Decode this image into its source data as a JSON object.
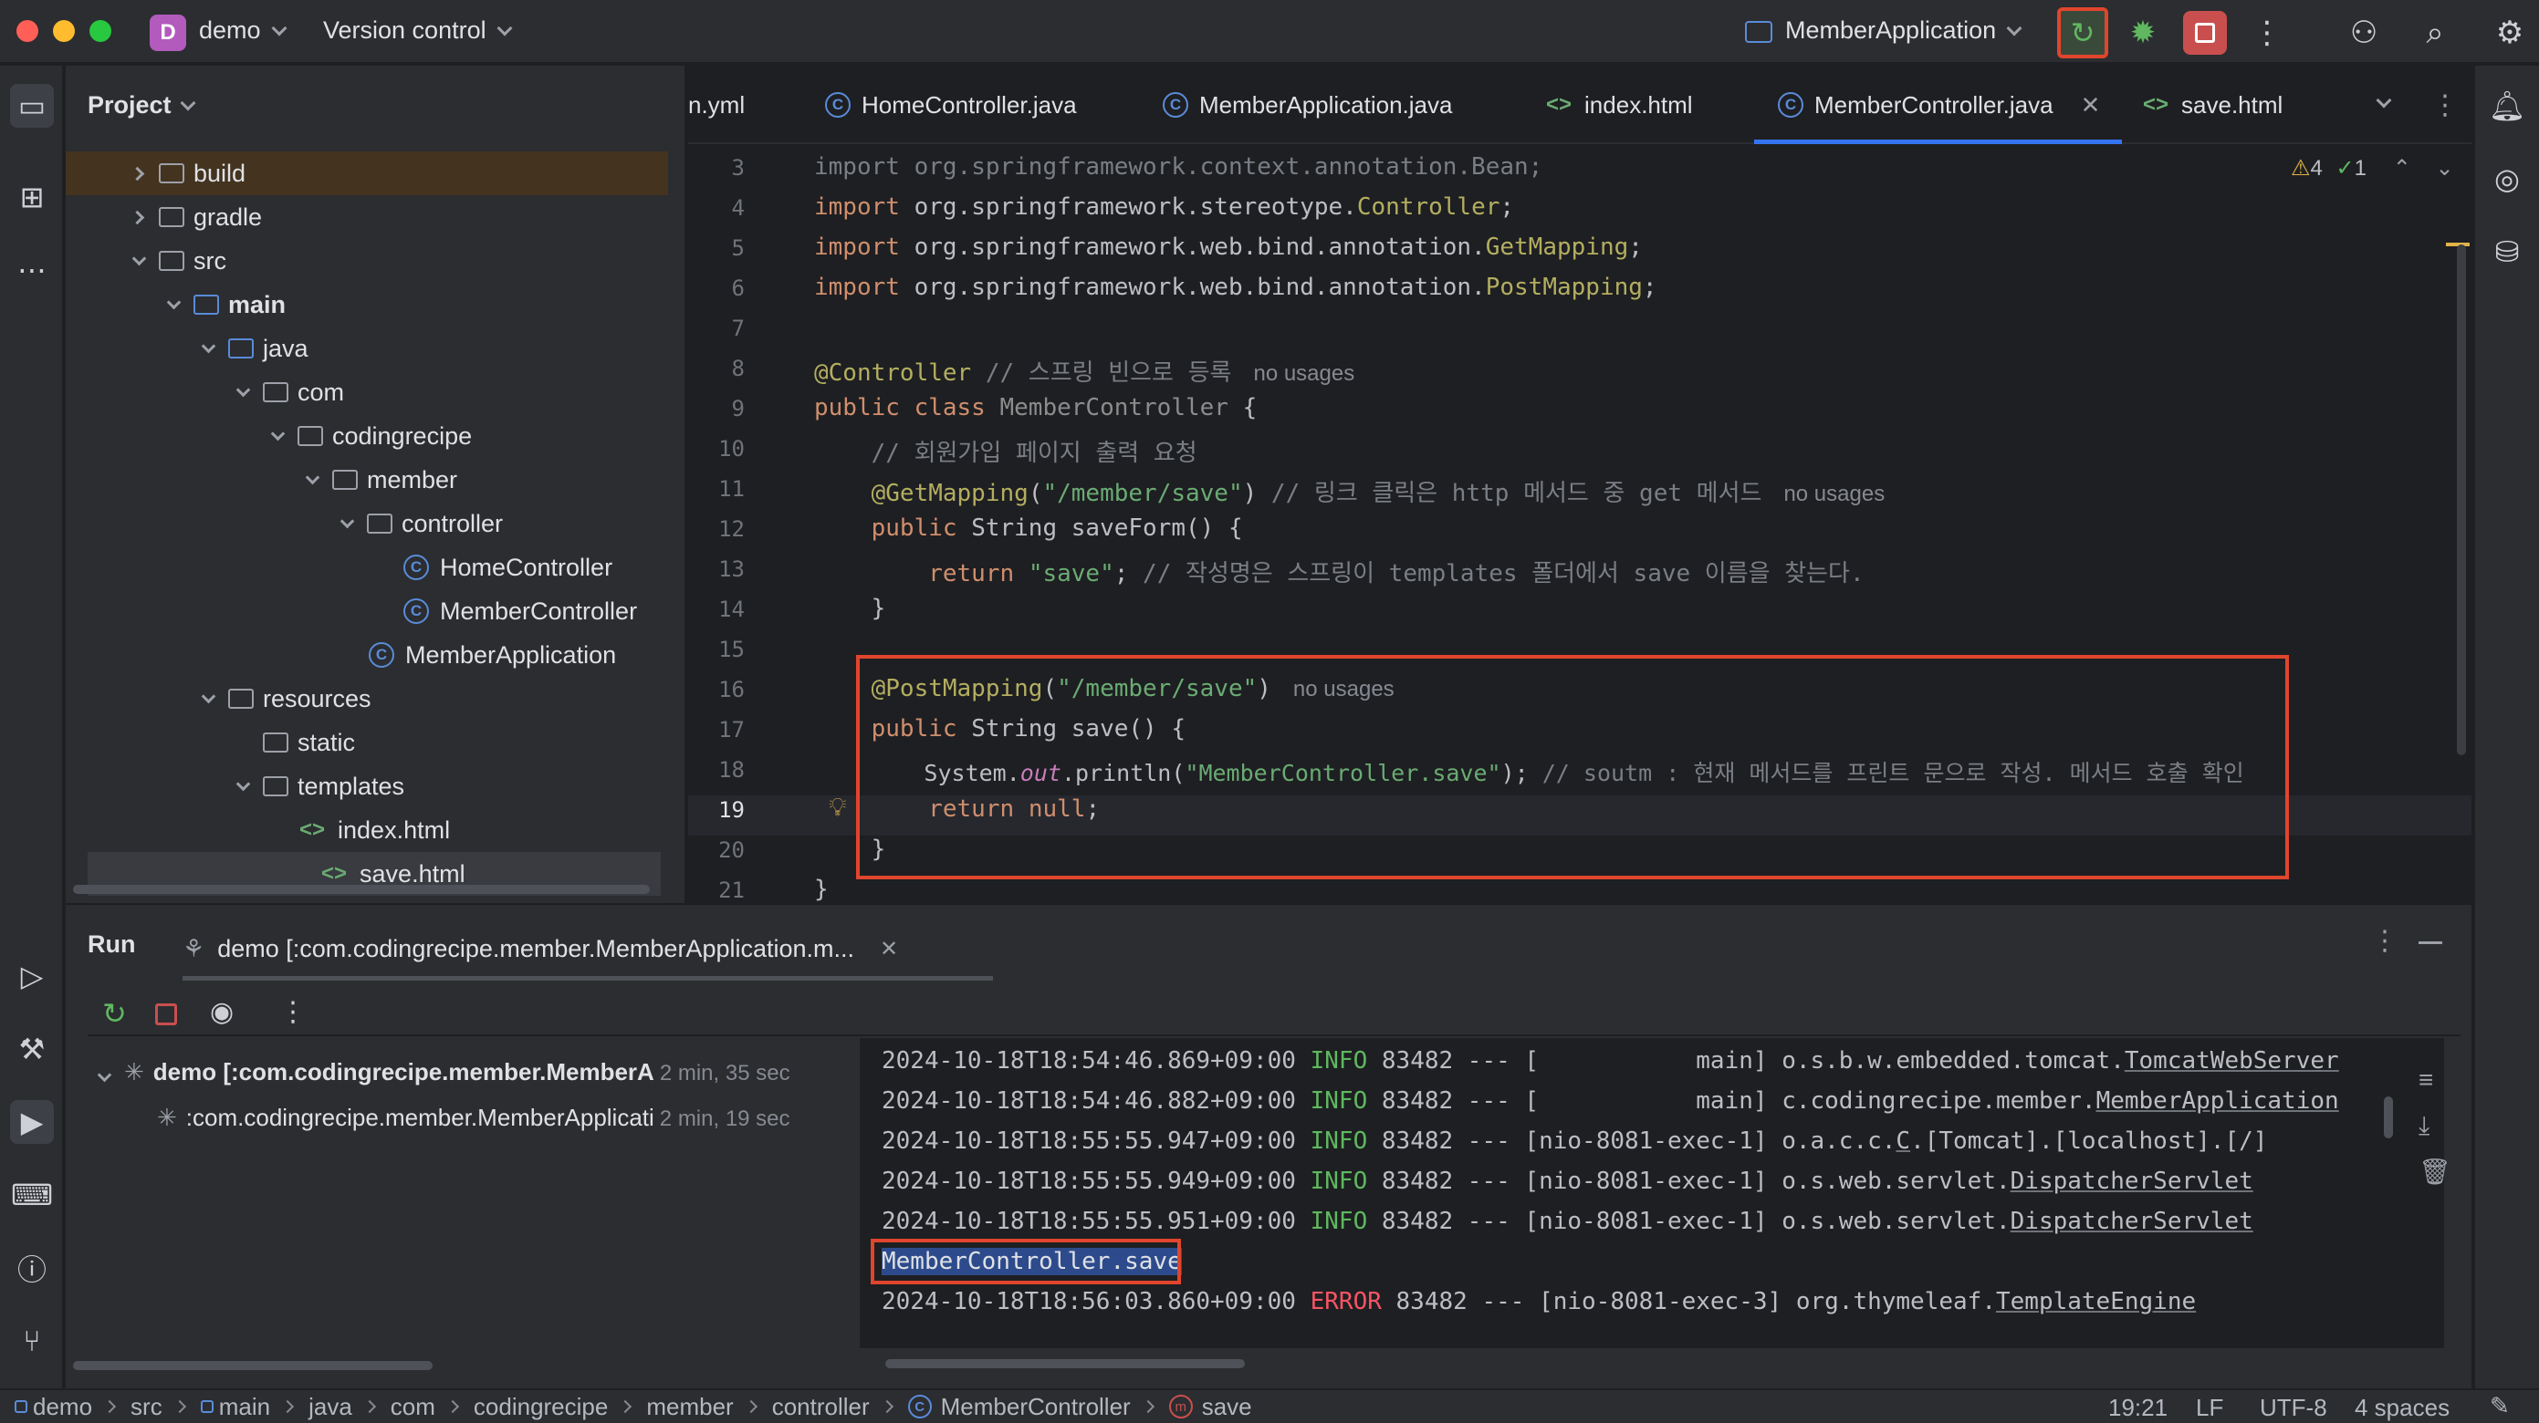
{
  "titlebar": {
    "project_initial": "D",
    "project_name": "demo",
    "vcs_label": "Version control",
    "run_config": "MemberApplication"
  },
  "project_panel": {
    "title": "Project",
    "tree": [
      {
        "label": "build",
        "depth": 0,
        "expanded": false,
        "type": "folder"
      },
      {
        "label": "gradle",
        "depth": 0,
        "expanded": false,
        "type": "folder"
      },
      {
        "label": "src",
        "depth": 0,
        "expanded": true,
        "type": "folder"
      },
      {
        "label": "main",
        "depth": 1,
        "expanded": true,
        "type": "folder"
      },
      {
        "label": "java",
        "depth": 2,
        "expanded": true,
        "type": "folder"
      },
      {
        "label": "com",
        "depth": 3,
        "expanded": true,
        "type": "package"
      },
      {
        "label": "codingrecipe",
        "depth": 4,
        "expanded": true,
        "type": "package"
      },
      {
        "label": "member",
        "depth": 5,
        "expanded": true,
        "type": "package"
      },
      {
        "label": "controller",
        "depth": 6,
        "expanded": true,
        "type": "package"
      },
      {
        "label": "HomeController",
        "depth": 7,
        "type": "class"
      },
      {
        "label": "MemberController",
        "depth": 7,
        "type": "class"
      },
      {
        "label": "MemberApplication",
        "depth": 6,
        "type": "class"
      },
      {
        "label": "resources",
        "depth": 2,
        "expanded": true,
        "type": "folder"
      },
      {
        "label": "static",
        "depth": 3,
        "type": "folder"
      },
      {
        "label": "templates",
        "depth": 3,
        "expanded": true,
        "type": "folder"
      },
      {
        "label": "index.html",
        "depth": 4,
        "type": "html"
      },
      {
        "label": "save.html",
        "depth": 4,
        "type": "html"
      }
    ]
  },
  "editor": {
    "tabs": [
      {
        "label": "n.yml",
        "type": "yml"
      },
      {
        "label": "HomeController.java",
        "type": "class"
      },
      {
        "label": "MemberApplication.java",
        "type": "class"
      },
      {
        "label": "index.html",
        "type": "html"
      },
      {
        "label": "MemberController.java",
        "type": "class",
        "active": true
      },
      {
        "label": "save.html",
        "type": "html"
      }
    ],
    "inspections": {
      "warnings": "4",
      "ok": "1"
    },
    "line_numbers": [
      "3",
      "4",
      "5",
      "6",
      "7",
      "8",
      "9",
      "10",
      "11",
      "12",
      "13",
      "14",
      "15",
      "16",
      "17",
      "18",
      "19",
      "20",
      "21"
    ],
    "lines": {
      "l3_kw": "import ",
      "l3_pkg": "org.springframework.context.annotation.Bean;",
      "l4_kw": "import ",
      "l4_pkg": "org.springframework.stereotype.",
      "l4_cls": "Controller",
      "l4_end": ";",
      "l5_kw": "import ",
      "l5_pkg": "org.springframework.web.bind.annotation.",
      "l5_cls": "GetMapping",
      "l5_end": ";",
      "l6_kw": "import ",
      "l6_pkg": "org.springframework.web.bind.annotation.",
      "l6_cls": "PostMapping",
      "l6_end": ";",
      "l8_ann": "@Controller",
      "l8_cmt": " // 스프링 빈으로 등록",
      "l8_usage": "no usages",
      "l9_kw": "public class ",
      "l9_cls": "MemberController",
      "l9_end": " {",
      "l10_cmt": "    // 회원가입 페이지 출력 요청",
      "l11_ann": "    @GetMapping",
      "l11_p1": "(",
      "l11_str": "\"/member/save\"",
      "l11_p2": ")",
      "l11_cmt": " // 링크 클릭은 http 메서드 중 get 메서드",
      "l11_usage": "no usages",
      "l12_kw": "    public ",
      "l12_type": "String ",
      "l12_fn": "saveForm",
      "l12_end": "() {",
      "l13_kw": "        return ",
      "l13_str": "\"save\"",
      "l13_end": ";",
      "l13_cmt": " // 작성명은 스프링이 templates 폴더에서 save 이름을 찾는다.",
      "l14": "    }",
      "l16_ann": "    @PostMapping",
      "l16_p1": "(",
      "l16_str": "\"/member/save\"",
      "l16_p2": ")",
      "l16_usage": "no usages",
      "l17_kw": "    public ",
      "l17_type": "String ",
      "l17_fn": "save",
      "l17_end": "() {",
      "l18_a": "        System.",
      "l18_out": "out",
      "l18_b": ".println(",
      "l18_str": "\"MemberController.save\"",
      "l18_c": ");",
      "l18_cmt": " // soutm : 현재 메서드를 프린트 문으로 작성. 메서드 호출 확인",
      "l19_kw": "        return ",
      "l19_null": "null",
      "l19_end": ";",
      "l20": "    }",
      "l21": "}"
    }
  },
  "run_panel": {
    "title": "Run",
    "tab_label": "demo [:com.codingrecipe.member.MemberApplication.m...",
    "tree": [
      {
        "label": "demo [:com.codingrecipe.member.MemberA",
        "time": "2 min, 35 sec"
      },
      {
        "label": ":com.codingrecipe.member.MemberApplicati",
        "time": "2 min, 19 sec"
      }
    ],
    "console": [
      {
        "ts": "2024-10-18T18:54:46.869+09:00",
        "lvl": " INFO",
        "pid": " 83482 --- [           main] ",
        "logger_prefix": "o.s.b.w.embedded.tomcat.",
        "logger": "TomcatWebServer"
      },
      {
        "ts": "2024-10-18T18:54:46.882+09:00",
        "lvl": " INFO",
        "pid": " 83482 --- [           main] ",
        "logger_prefix": "c.codingrecipe.member.",
        "logger": "MemberApplication"
      },
      {
        "ts": "2024-10-18T18:55:55.947+09:00",
        "lvl": " INFO",
        "pid": " 83482 --- [nio-8081-exec-1] ",
        "logger_prefix": "o.a.c.c.",
        "logger": "C",
        "logger_suffix": ".[Tomcat].[localhost].[/]"
      },
      {
        "ts": "2024-10-18T18:55:55.949+09:00",
        "lvl": " INFO",
        "pid": " 83482 --- [nio-8081-exec-1] ",
        "logger_prefix": "o.s.web.servlet.",
        "logger": "DispatcherServlet"
      },
      {
        "ts": "2024-10-18T18:55:55.951+09:00",
        "lvl": " INFO",
        "pid": " 83482 --- [nio-8081-exec-1] ",
        "logger_prefix": "o.s.web.servlet.",
        "logger": "DispatcherServlet"
      },
      {
        "output": "MemberController.save"
      },
      {
        "ts": "2024-10-18T18:56:03.860+09:00",
        "lvl": " ERROR",
        "pid": " 83482 --- [nio-8081-exec-3] ",
        "logger_prefix": "org.thymeleaf.",
        "logger": "TemplateEngine"
      }
    ]
  },
  "statusbar": {
    "breadcrumbs": [
      "demo",
      "src",
      "main",
      "java",
      "com",
      "codingrecipe",
      "member",
      "controller",
      "MemberController",
      "save"
    ],
    "position": "19:21",
    "line_sep": "LF",
    "encoding": "UTF-8",
    "indent": "4 spaces"
  },
  "colors": {
    "accent": "#3574f0",
    "highlight_box": "#e0452d",
    "keyword": "#cf8e6d",
    "annotation": "#b3ae60",
    "string": "#6aab73"
  }
}
